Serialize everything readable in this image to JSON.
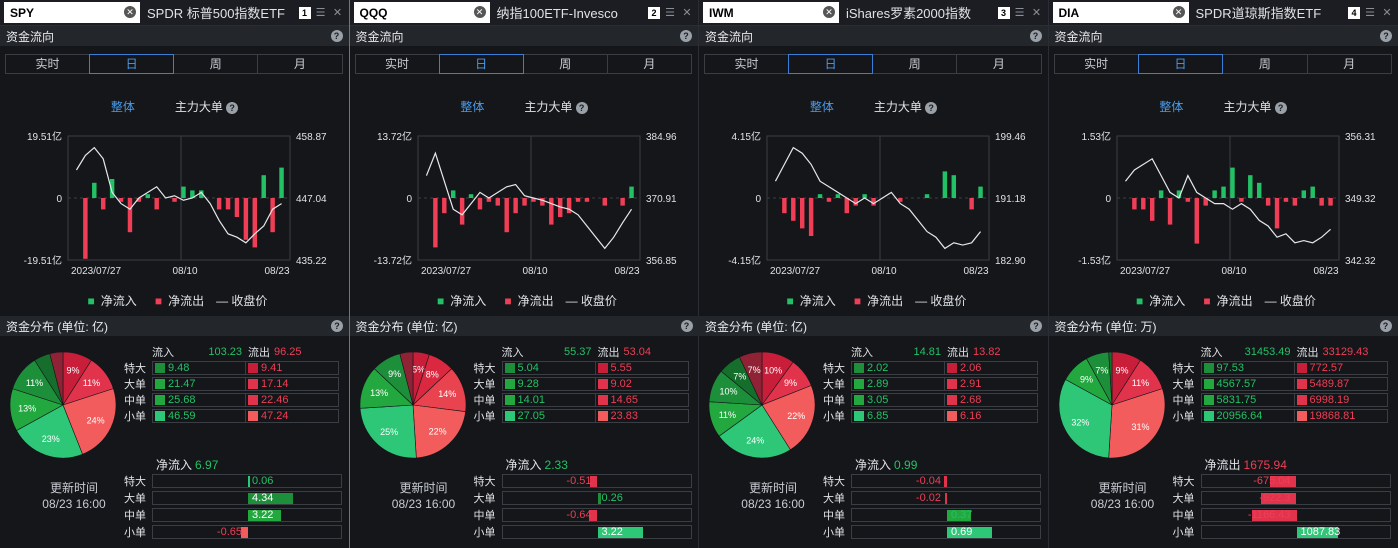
{
  "colors": {
    "in": "#23c165",
    "out": "#ef3e55",
    "accent": "#4a9be8"
  },
  "labels": {
    "fund_flow": "资金流向",
    "tabs": [
      "实时",
      "日",
      "周",
      "月"
    ],
    "whole": "整体",
    "main": "主力大单",
    "legend_in": "净流入",
    "legend_out": "净流出",
    "legend_close": "收盘价",
    "update": "更新时间",
    "rows": [
      "特大",
      "大单",
      "中单",
      "小单"
    ],
    "in": "流入",
    "out": "流出"
  },
  "panels": [
    {
      "symbol": "SPY",
      "name": "SPDR 标普500指数ETF",
      "index": "1",
      "dist_title": "资金分布 (单位: 亿)",
      "chart": {
        "ytop": "19.51亿",
        "ymid": "0",
        "ybot": "-19.51亿",
        "rtop": "458.87",
        "rmid": "447.04",
        "rbot": "435.22",
        "dates": [
          "2023/07/27",
          "08/10",
          "08/23"
        ],
        "bars": [
          0,
          -16,
          4,
          -3,
          5,
          -1,
          -9,
          -1,
          1,
          -3,
          0,
          -1,
          3,
          2,
          2,
          0,
          -3,
          -3,
          -5,
          -11,
          -13,
          6,
          -9,
          8
        ],
        "close": [
          0.25,
          0.12,
          0.05,
          0.15,
          0.45,
          0.55,
          0.6,
          0.5,
          0.45,
          0.4,
          0.5,
          0.48,
          0.52,
          0.5,
          0.45,
          0.55,
          0.7,
          0.82,
          0.85,
          0.9,
          0.82,
          0.75,
          0.6,
          0.55
        ]
      },
      "pie": [
        {
          "v": 9,
          "c": "#c81e3a",
          "t": "9%"
        },
        {
          "v": 11,
          "c": "#e2334c",
          "t": "11%"
        },
        {
          "v": 24,
          "c": "#f25c5c",
          "t": "24%"
        },
        {
          "v": 23,
          "c": "#2ec778",
          "t": "23%"
        },
        {
          "v": 13,
          "c": "#22a83f",
          "t": "13%"
        },
        {
          "v": 11,
          "c": "#1d8f3b",
          "t": "11%"
        },
        {
          "v": 5,
          "c": "#156e2c",
          "t": ""
        },
        {
          "v": 4,
          "c": "#8f2235",
          "t": ""
        }
      ],
      "in_total": "103.23",
      "out_total": "96.25",
      "in": [
        "9.48",
        "21.47",
        "25.68",
        "46.59"
      ],
      "out": [
        "9.41",
        "17.14",
        "22.46",
        "47.24"
      ],
      "net_title": "净流入",
      "net_total": "6.97",
      "net_color": "in",
      "net": [
        "0.06",
        "4.34",
        "3.22",
        "-0.65"
      ],
      "date": "08/23 16:00"
    },
    {
      "symbol": "QQQ",
      "name": "纳指100ETF-Invesco",
      "index": "2",
      "dist_title": "资金分布 (单位: 亿)",
      "chart": {
        "ytop": "13.72亿",
        "ymid": "0",
        "ybot": "-13.72亿",
        "rtop": "384.96",
        "rmid": "370.91",
        "rbot": "356.85",
        "dates": [
          "2023/07/27",
          "08/10",
          "08/23"
        ],
        "bars": [
          0,
          -13,
          -4,
          2,
          -7,
          1,
          -3,
          -1,
          -2,
          -9,
          -4,
          -2,
          -1,
          -2,
          -7,
          -5,
          -4,
          -1,
          -1,
          0,
          -2,
          0,
          -2,
          3
        ],
        "close": [
          0.3,
          0.1,
          0.35,
          0.6,
          0.65,
          0.55,
          0.45,
          0.5,
          0.45,
          0.4,
          0.38,
          0.48,
          0.5,
          0.52,
          0.55,
          0.58,
          0.6,
          0.65,
          0.75,
          0.85,
          0.95,
          0.85,
          0.72,
          0.6
        ]
      },
      "pie": [
        {
          "v": 5,
          "c": "#c81e3a",
          "t": "5%"
        },
        {
          "v": 8,
          "c": "#d9283f",
          "t": "8%"
        },
        {
          "v": 14,
          "c": "#ea4350",
          "t": "14%"
        },
        {
          "v": 22,
          "c": "#f25c5c",
          "t": "22%"
        },
        {
          "v": 25,
          "c": "#2ec778",
          "t": "25%"
        },
        {
          "v": 13,
          "c": "#22a83f",
          "t": "13%"
        },
        {
          "v": 9,
          "c": "#1d8f3b",
          "t": "9%"
        },
        {
          "v": 4,
          "c": "#8f2235",
          "t": ""
        }
      ],
      "in_total": "55.37",
      "out_total": "53.04",
      "in": [
        "5.04",
        "9.28",
        "14.01",
        "27.05"
      ],
      "out": [
        "5.55",
        "9.02",
        "14.65",
        "23.83"
      ],
      "net_title": "净流入",
      "net_total": "2.33",
      "net_color": "in",
      "net": [
        "-0.51",
        "0.26",
        "-0.64",
        "3.22"
      ],
      "date": "08/23 16:00"
    },
    {
      "symbol": "IWM",
      "name": "iShares罗素2000指数",
      "index": "3",
      "dist_title": "资金分布 (单位: 亿)",
      "chart": {
        "ytop": "4.15亿",
        "ymid": "0",
        "ybot": "-4.15亿",
        "rtop": "199.46",
        "rmid": "191.18",
        "rbot": "182.90",
        "dates": [
          "2023/07/27",
          "08/10",
          "08/23"
        ],
        "bars": [
          0,
          -4,
          -6,
          -8,
          -10,
          1,
          -1,
          1,
          -4,
          -2,
          1,
          -2,
          0,
          0,
          -1,
          0,
          0,
          1,
          0,
          7,
          6,
          0,
          -3,
          3
        ],
        "close": [
          0.35,
          0.2,
          0.05,
          0.1,
          0.2,
          0.35,
          0.4,
          0.45,
          0.5,
          0.55,
          0.5,
          0.55,
          0.5,
          0.45,
          0.55,
          0.6,
          0.7,
          0.8,
          0.85,
          0.95,
          0.9,
          0.92,
          0.9,
          0.8
        ]
      },
      "pie": [
        {
          "v": 10,
          "c": "#c81e3a",
          "t": "10%"
        },
        {
          "v": 9,
          "c": "#e2334c",
          "t": "9%"
        },
        {
          "v": 22,
          "c": "#f25c5c",
          "t": "22%"
        },
        {
          "v": 24,
          "c": "#2ec778",
          "t": "24%"
        },
        {
          "v": 11,
          "c": "#22a83f",
          "t": "11%"
        },
        {
          "v": 10,
          "c": "#1d8f3b",
          "t": "10%"
        },
        {
          "v": 7,
          "c": "#156e2c",
          "t": "7%"
        },
        {
          "v": 7,
          "c": "#8f2235",
          "t": "7%"
        }
      ],
      "in_total": "14.81",
      "out_total": "13.82",
      "in": [
        "2.02",
        "2.89",
        "3.05",
        "6.85"
      ],
      "out": [
        "2.06",
        "2.91",
        "2.68",
        "6.16"
      ],
      "net_title": "净流入",
      "net_total": "0.99",
      "net_color": "in",
      "net": [
        "-0.04",
        "-0.02",
        "0.37",
        "0.69"
      ],
      "date": "08/23 16:00"
    },
    {
      "symbol": "DIA",
      "name": "SPDR道琼斯指数ETF",
      "index": "4",
      "dist_title": "资金分布 (单位: 万)",
      "chart": {
        "ytop": "1.53亿",
        "ymid": "0",
        "ybot": "-1.53亿",
        "rtop": "356.31",
        "rmid": "349.32",
        "rbot": "342.32",
        "dates": [
          "2023/07/27",
          "08/10",
          "08/23"
        ],
        "bars": [
          0,
          -3,
          -3,
          -6,
          2,
          -7,
          2,
          -1,
          -12,
          -2,
          2,
          3,
          8,
          -1,
          6,
          4,
          -2,
          -8,
          -1,
          -2,
          2,
          3,
          -2,
          -2
        ],
        "close": [
          0.35,
          0.25,
          0.2,
          0.15,
          0.3,
          0.45,
          0.5,
          0.3,
          0.45,
          0.5,
          0.55,
          0.55,
          0.6,
          0.55,
          0.6,
          0.7,
          0.75,
          0.85,
          0.82,
          0.9,
          0.88,
          0.9,
          0.85,
          0.78
        ]
      },
      "pie": [
        {
          "v": 9,
          "c": "#c81e3a",
          "t": "9%"
        },
        {
          "v": 11,
          "c": "#e2334c",
          "t": "11%"
        },
        {
          "v": 31,
          "c": "#f25c5c",
          "t": "31%"
        },
        {
          "v": 32,
          "c": "#2ec778",
          "t": "32%"
        },
        {
          "v": 9,
          "c": "#22a83f",
          "t": "9%"
        },
        {
          "v": 7,
          "c": "#1d8f3b",
          "t": "7%"
        },
        {
          "v": 1,
          "c": "#156e2c",
          "t": ""
        }
      ],
      "in_total": "31453.49",
      "out_total": "33129.43",
      "in": [
        "97.53",
        "4567.57",
        "5831.75",
        "20956.64"
      ],
      "out": [
        "772.57",
        "5489.87",
        "6998.19",
        "19868.81"
      ],
      "net_title": "净流出",
      "net_total": "1675.94",
      "net_color": "out",
      "net": [
        "-675.04",
        "-922.3",
        "-1166.43",
        "1087.83"
      ],
      "date": "08/23 16:00"
    }
  ]
}
